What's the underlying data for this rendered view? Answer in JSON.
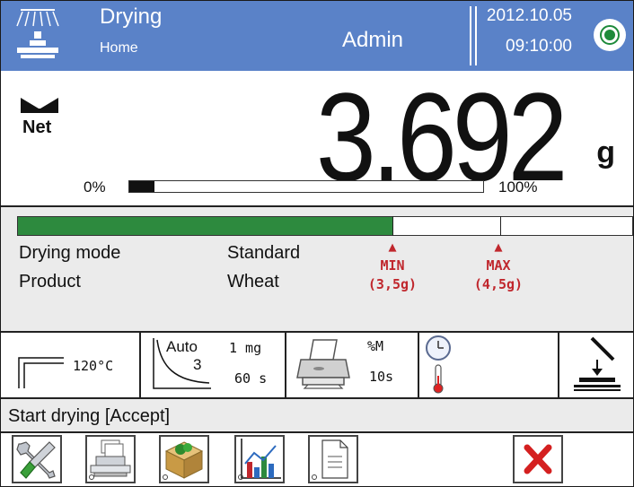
{
  "header": {
    "mode_title": "Drying",
    "mode_subtitle": "Home",
    "user": "Admin",
    "date": "2012.10.05",
    "time": "09:10:00"
  },
  "weighing": {
    "net_label": "Net",
    "reading": "3.692",
    "unit": "g",
    "capacity_min_label": "0%",
    "capacity_max_label": "100%",
    "capacity_fill": 0.07
  },
  "drying_info": {
    "progress_fill": 0.61,
    "rows": [
      {
        "label": "Drying mode",
        "value": "Standard"
      },
      {
        "label": "Product",
        "value": "Wheat"
      }
    ],
    "min_marker": {
      "label": "MIN",
      "value": "(3,5g)"
    },
    "max_marker": {
      "label": "MAX",
      "value": "(4,5g)"
    }
  },
  "shortcuts": {
    "temperature": "120°C",
    "finish_mode": "Auto",
    "finish_value": "3",
    "finish_weight": "1 mg",
    "finish_time": "60 s",
    "print_label": "%M",
    "print_interval": "10s"
  },
  "status": {
    "text": "Start drying [Accept]"
  },
  "colors": {
    "header_bg": "#5a82c8",
    "progress_green": "#2d8a3e",
    "marker_red": "#c0272d",
    "cancel_red": "#d42020"
  },
  "icons": {
    "header": [
      "balance-logo-icon",
      "level-indicator-icon"
    ],
    "buttons": [
      "settings-tools-icon",
      "database-icon",
      "product-box-icon",
      "chart-icon",
      "report-document-icon",
      "cancel-icon"
    ]
  }
}
